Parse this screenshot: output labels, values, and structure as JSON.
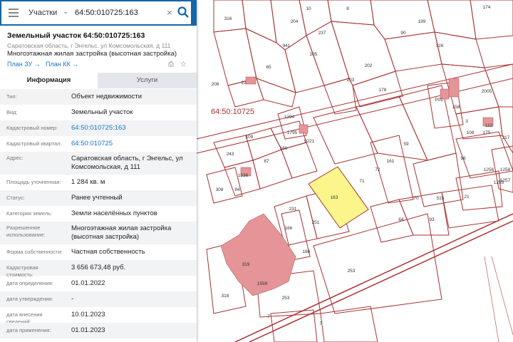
{
  "search": {
    "type_label": "Участки",
    "query": "64:50:010725:163"
  },
  "object": {
    "title": "Земельный участок 64:50:010725:163",
    "address": "Саратовская область, г Энгельс, ул Комсомольская, д 111",
    "permitted_use": "Многоэтажная жилая застройка (высотная застройка)",
    "plan_zu": "План ЗУ →",
    "plan_kk": "План КК →"
  },
  "tabs": {
    "info": "Информация",
    "services": "Услуги"
  },
  "info_rows": [
    {
      "label": "Тип:",
      "value": "Объект недвижимости"
    },
    {
      "label": "Вид:",
      "value": "Земельный участок"
    },
    {
      "label": "Кадастровый номер:",
      "value": "64:50:010725:163"
    },
    {
      "label": "Кадастровый квартал:",
      "value": "64:50:010725"
    },
    {
      "label": "Адрес:",
      "value": "Саратовская область, г Энгельс, ул Комсомольская, д 111"
    },
    {
      "label": "Площадь уточненная:",
      "value": "1 284 кв. м"
    },
    {
      "label": "Статус:",
      "value": "Ранее учтенный"
    },
    {
      "label": "Категория земель:",
      "value": "Земли населённых пунктов"
    },
    {
      "label": "Разрешенное использование:",
      "value": "Многоэтажная жилая застройка (высотная застройка)"
    },
    {
      "label": "Форма собственности:",
      "value": "Частная собственность"
    },
    {
      "label": "Кадастровая стоимость:",
      "value": "3 656 673,48 руб."
    },
    {
      "label": "дата определения:",
      "value": "01.01.2022"
    },
    {
      "label": "дата утверждения:",
      "value": "-"
    },
    {
      "label": "дата внесения сведений:",
      "value": "10.01.2023"
    },
    {
      "label": "дата применения:",
      "value": "01.01.2023"
    }
  ],
  "map": {
    "quarter_label": "64:50:10725",
    "plot_labels": [
      "10",
      "8",
      "174",
      "316",
      "204",
      "237",
      "205",
      "199",
      "90",
      "326",
      "941",
      "206",
      "65",
      "22",
      "202",
      "178",
      "203",
      "2005",
      "P01",
      "158",
      "3",
      "108",
      "112",
      "175",
      "317",
      "1294",
      "1795",
      "109",
      "243",
      "1536",
      "160",
      "87",
      "9221",
      "84",
      "308",
      "1256",
      "1258",
      "1257",
      "59",
      "161",
      "72",
      "71",
      "163",
      "96",
      "1255",
      "21",
      "251",
      "231",
      "166",
      "166",
      "70",
      "515",
      "64",
      "93",
      "319",
      "1559",
      "253",
      "318",
      "253",
      "7",
      "7"
    ],
    "highlighted_plot": "163",
    "colors": {
      "boundary": "#a83232",
      "building": "#e59597",
      "highlight": "#fbf58c",
      "road": "#b03030",
      "panel_header": "#1565a8",
      "link": "#1a73c8"
    }
  }
}
